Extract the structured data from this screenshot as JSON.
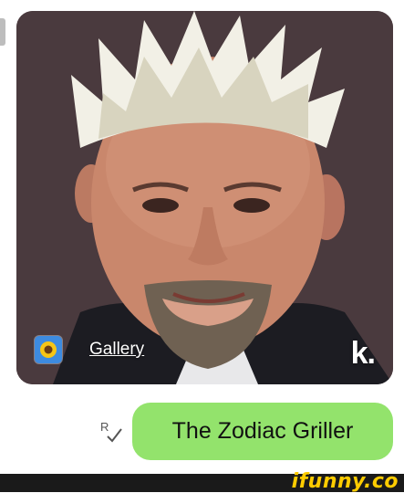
{
  "image_card": {
    "gallery_label": "Gallery",
    "gallery_icon": "sunflower-icon",
    "app_logo": "k."
  },
  "message": {
    "text": "The Zodiac Griller",
    "status_icon": "read-receipt-icon",
    "bubble_color": "#93e36c"
  },
  "watermark": {
    "text": "ifunny.co"
  }
}
